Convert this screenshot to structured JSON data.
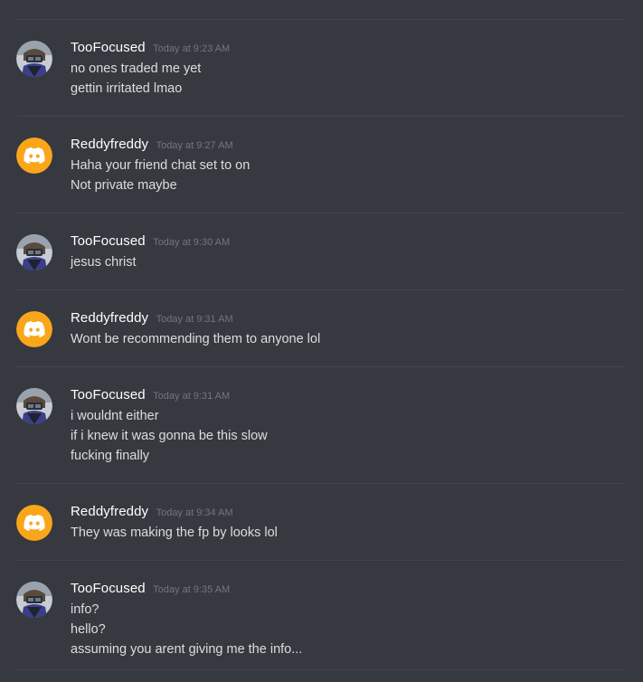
{
  "messages": [
    {
      "author": "TooFocused",
      "avatar_icon": "user-photo-avatar",
      "timestamp": "Today at 9:23 AM",
      "lines": [
        "no ones traded me yet",
        "gettin irritated lmao"
      ]
    },
    {
      "author": "Reddyfreddy",
      "avatar_icon": "discord-logo-avatar",
      "avatar_color": "#faa61a",
      "timestamp": "Today at 9:27 AM",
      "lines": [
        "Haha your friend chat set to on",
        "Not private maybe"
      ]
    },
    {
      "author": "TooFocused",
      "avatar_icon": "user-photo-avatar",
      "timestamp": "Today at 9:30 AM",
      "lines": [
        "jesus christ"
      ]
    },
    {
      "author": "Reddyfreddy",
      "avatar_icon": "discord-logo-avatar",
      "avatar_color": "#faa61a",
      "timestamp": "Today at 9:31 AM",
      "lines": [
        "Wont be recommending them to anyone lol"
      ]
    },
    {
      "author": "TooFocused",
      "avatar_icon": "user-photo-avatar",
      "timestamp": "Today at 9:31 AM",
      "lines": [
        "i wouldnt either",
        "if i knew it was gonna be this slow",
        "fucking finally"
      ]
    },
    {
      "author": "Reddyfreddy",
      "avatar_icon": "discord-logo-avatar",
      "avatar_color": "#faa61a",
      "timestamp": "Today at 9:34 AM",
      "lines": [
        "They was making the fp by looks lol"
      ]
    },
    {
      "author": "TooFocused",
      "avatar_icon": "user-photo-avatar",
      "timestamp": "Today at 9:35 AM",
      "lines": [
        "info?",
        "hello?",
        "assuming you arent giving me the info..."
      ]
    }
  ]
}
